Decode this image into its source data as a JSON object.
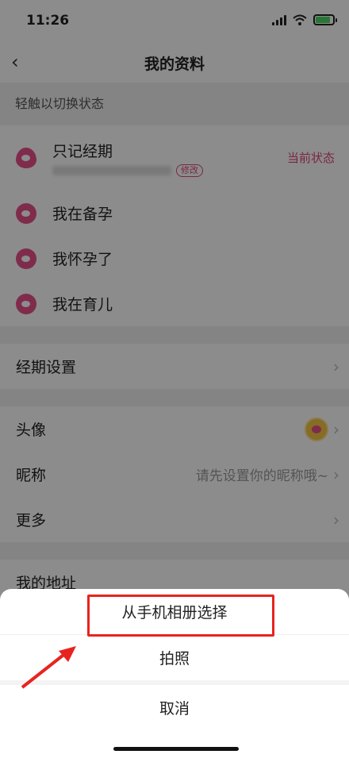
{
  "status": {
    "time": "11:26"
  },
  "nav": {
    "title": "我的资料",
    "back_icon": "back-chevron-icon"
  },
  "hint": "轻触以切换状态",
  "states": [
    {
      "label": "只记经期",
      "edit": "修改",
      "current": "当前状态"
    },
    {
      "label": "我在备孕"
    },
    {
      "label": "我怀孕了"
    },
    {
      "label": "我在育儿"
    }
  ],
  "period_settings": {
    "label": "经期设置"
  },
  "profile": {
    "avatar_label": "头像",
    "nickname_label": "昵称",
    "nickname_placeholder": "请先设置你的昵称哦~",
    "more_label": "更多"
  },
  "address_label": "我的地址",
  "sheet": {
    "album": "从手机相册选择",
    "camera": "拍照",
    "cancel": "取消"
  },
  "colors": {
    "accent": "#e0457d",
    "highlight": "#e8231f"
  }
}
